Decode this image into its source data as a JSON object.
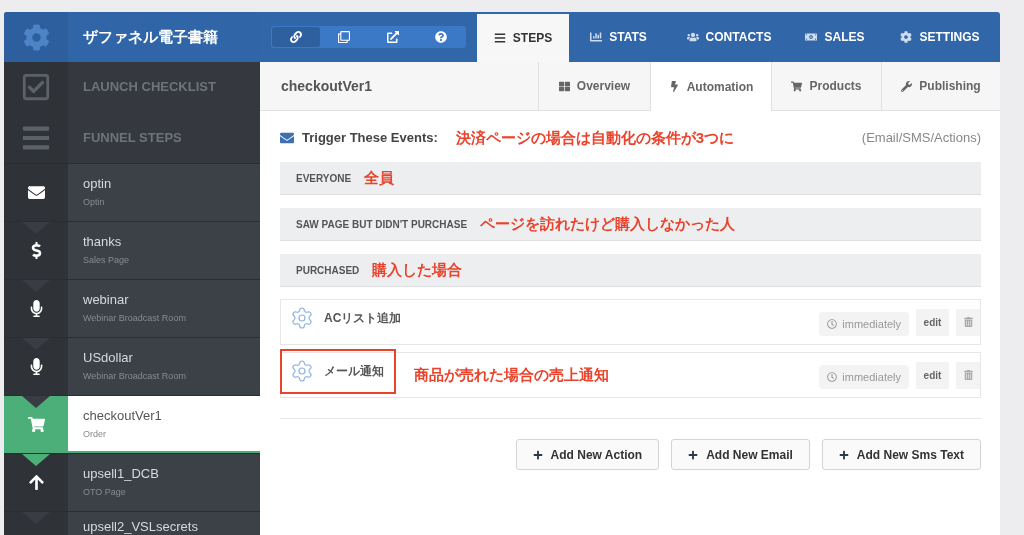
{
  "app": {
    "title": "ザファネル電子書籍"
  },
  "toolbar": [
    {
      "kind": "link",
      "selected": true
    },
    {
      "kind": "copy",
      "selected": false
    },
    {
      "kind": "external",
      "selected": false
    },
    {
      "kind": "help",
      "selected": false
    }
  ],
  "nav_tabs": [
    {
      "label": "STEPS",
      "kind": "steps",
      "selected": true
    },
    {
      "label": "STATS",
      "kind": "stats",
      "selected": false
    },
    {
      "label": "CONTACTS",
      "kind": "contacts",
      "selected": false
    },
    {
      "label": "SALES",
      "kind": "sales",
      "selected": false
    },
    {
      "label": "SETTINGS",
      "kind": "settings",
      "selected": false
    }
  ],
  "sidebar": {
    "sections": [
      {
        "label": "LAUNCH CHECKLIST",
        "kind": "checklist"
      },
      {
        "label": "FUNNEL STEPS",
        "kind": "steps"
      }
    ],
    "steps": [
      {
        "name": "optin",
        "type": "Optin",
        "kind": "optin",
        "selected": false
      },
      {
        "name": "thanks",
        "type": "Sales Page",
        "kind": "sales",
        "selected": false
      },
      {
        "name": "webinar",
        "type": "Webinar Broadcast Room",
        "kind": "webinar",
        "selected": false
      },
      {
        "name": "USdollar",
        "type": "Webinar Broadcast Room",
        "kind": "webinar",
        "selected": false
      },
      {
        "name": "checkoutVer1",
        "type": "Order",
        "kind": "order",
        "selected": true
      },
      {
        "name": "upsell1_DCB",
        "type": "OTO Page",
        "kind": "oto",
        "selected": false
      },
      {
        "name": "upsell2_VSLsecrets",
        "selected": false
      }
    ]
  },
  "page": {
    "title": "checkoutVer1",
    "tabs": [
      {
        "label": "Overview",
        "kind": "overview",
        "selected": false
      },
      {
        "label": "Automation",
        "kind": "automation",
        "selected": true
      },
      {
        "label": "Products",
        "kind": "products",
        "selected": false
      },
      {
        "label": "Publishing",
        "kind": "publishing",
        "selected": false
      }
    ],
    "trigger": {
      "label": "Trigger These Events:",
      "annotation": "決済ページの場合は自動化の条件が3つに",
      "hint": "(Email/SMS/Actions)"
    },
    "events": [
      {
        "label": "EVERYONE",
        "annotation": "全員"
      },
      {
        "label": "SAW PAGE BUT DIDN'T PURCHASE",
        "annotation": "ページを訪れたけど購入しなかった人"
      },
      {
        "label": "PURCHASED",
        "annotation": "購入した場合"
      }
    ],
    "actions": [
      {
        "name": "ACリスト追加",
        "timing": "immediately",
        "edit": "edit",
        "highlighted": false
      },
      {
        "name": "メール通知",
        "timing": "immediately",
        "edit": "edit",
        "highlighted": true,
        "annotation": "商品が売れた場合の売上通知"
      }
    ],
    "buttons": [
      "Add New Action",
      "Add New Email",
      "Add New Sms Text"
    ]
  }
}
